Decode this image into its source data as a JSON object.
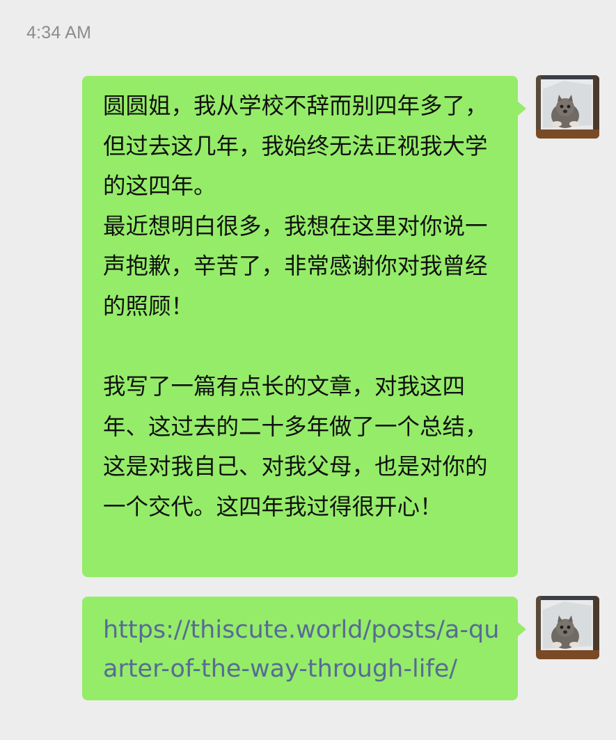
{
  "chat": {
    "timestamp": "4:34 AM",
    "messages": [
      {
        "type": "text",
        "sender": "self",
        "text": "圆圆姐，我从学校不辞而别四年多了，但过去这几年，我始终无法正视我大学的这四年。\n最近想明白很多，我想在这里对你说一声抱歉，辛苦了，非常感谢你对我曾经的照顾！\n\n我写了一篇有点长的文章，对我这四年、这过去的二十多年做了一个总结，这是对我自己、对我父母，也是对你的一个交代。这四年我过得很开心！"
      },
      {
        "type": "link",
        "sender": "self",
        "text": "https://thiscute.world/posts/a-quarter-of-the-way-through-life/"
      }
    ]
  },
  "colors": {
    "background": "#ededed",
    "bubble_self": "#95ec69",
    "link": "#576b95",
    "timestamp": "#8c8c8c"
  }
}
